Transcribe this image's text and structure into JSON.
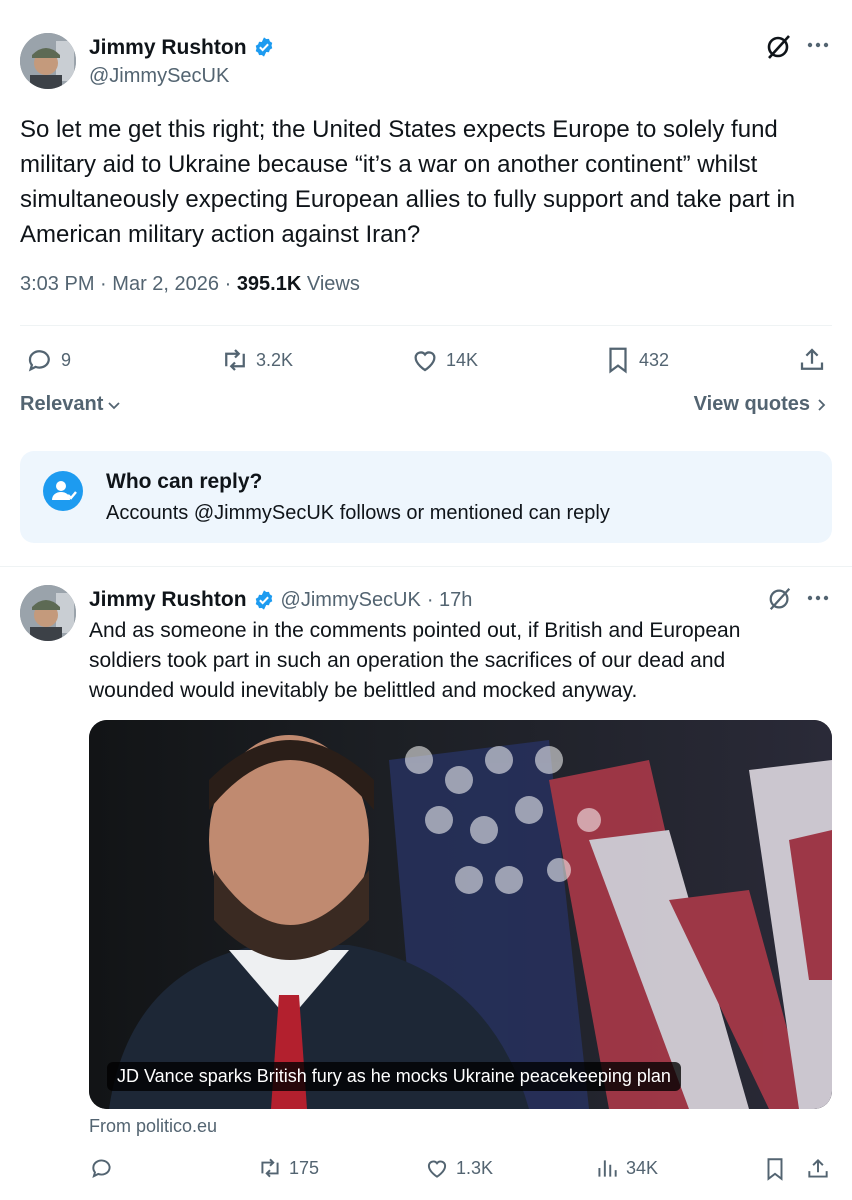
{
  "main_tweet": {
    "author_name": "Jimmy Rushton",
    "handle": "@JimmySecUK",
    "text": "So let me get this right; the United States expects Europe to solely fund military aid to Ukraine because “it’s a war on another continent” whilst simultaneously expecting European allies to fully support and take part in American military action against Iran?",
    "time": "3:03 PM",
    "sep": "·",
    "date": "Mar 2, 2026",
    "views_count": "395.1K",
    "views_label": "Views",
    "replies": "9",
    "retweets": "3.2K",
    "likes": "14K",
    "bookmarks": "432"
  },
  "sort": {
    "relevant_label": "Relevant",
    "view_quotes_label": "View quotes"
  },
  "reply_restriction": {
    "title": "Who can reply?",
    "text": "Accounts @JimmySecUK follows or mentioned can reply"
  },
  "reply_tweet": {
    "author_name": "Jimmy Rushton",
    "handle": "@JimmySecUK",
    "age": "· 17h",
    "text": "And as someone in the comments pointed out, if British and European soldiers took part in such an operation the sacrifices of our dead and wounded would inevitably be belittled and mocked anyway.",
    "card_caption": "JD Vance sparks British fury as he mocks Ukraine peacekeeping plan",
    "card_source": "From politico.eu",
    "replies": "",
    "retweets": "175",
    "likes": "1.3K",
    "views": "34K"
  },
  "colors": {
    "verified": "#1d9bf0",
    "reply_card_bg": "#eef6fd",
    "muted": "#536471"
  }
}
